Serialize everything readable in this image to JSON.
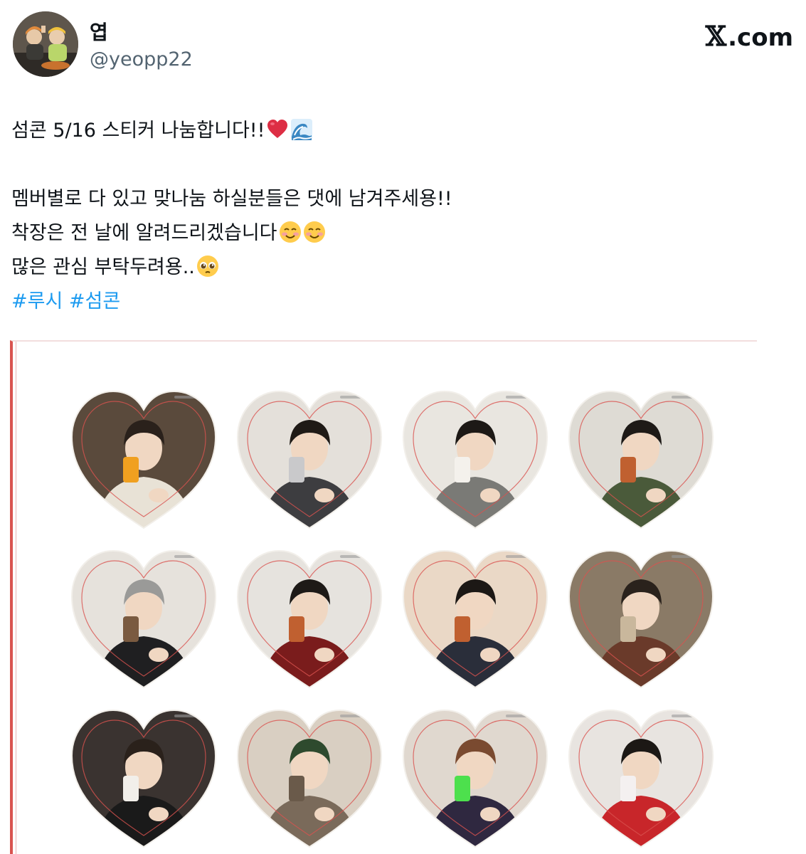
{
  "author": {
    "display_name": "엽",
    "handle": "@yeopp22",
    "avatar": "profile-photo"
  },
  "branding": {
    "logo_mark": "𝕏",
    "logo_text": ".com"
  },
  "tweet": {
    "line1": "섬콘 5/16 스티커 나눔합니다!!",
    "line1_emojis": [
      "red-heart",
      "water-wave"
    ],
    "line2": "멤버별로 다 있고 맞나눔 하실분들은 댓에 남겨주세용!!",
    "line3": "착장은 전 날에 알려드리겠습니다",
    "line3_emojis": [
      "smiling-face",
      "smiling-face"
    ],
    "line4": "많은 관심 부탁두려용..",
    "line4_emojis": [
      "pleading-face"
    ],
    "hashtags": [
      "#루시",
      "#섬콘"
    ]
  },
  "media": {
    "stickers": [
      {
        "bg": "#5a4a3c",
        "shirt": "#e8e2d6",
        "hair": "#2a211b",
        "accent": "#f0a020"
      },
      {
        "bg": "#e4e0da",
        "shirt": "#3d3d40",
        "hair": "#1f1a16",
        "accent": "#c9c9cb"
      },
      {
        "bg": "#e9e6e0",
        "shirt": "#7a7a76",
        "hair": "#1d1916",
        "accent": "#f4f1ec"
      },
      {
        "bg": "#dedbd4",
        "shirt": "#4a5a3a",
        "hair": "#1e1a17",
        "accent": "#c06030"
      },
      {
        "bg": "#e6e2dc",
        "shirt": "#1f1f21",
        "hair": "#9a9a98",
        "accent": "#7a5a40"
      },
      {
        "bg": "#e6e3de",
        "shirt": "#7a1c1c",
        "hair": "#1e1a17",
        "accent": "#c06030"
      },
      {
        "bg": "#ead8c6",
        "shirt": "#2a2e3a",
        "hair": "#1c1815",
        "accent": "#c06030"
      },
      {
        "bg": "#8a7a66",
        "shirt": "#6a3a2a",
        "hair": "#2a221c",
        "accent": "#c9b79c"
      },
      {
        "bg": "#3a3330",
        "shirt": "#1a1a1a",
        "hair": "#2a211b",
        "accent": "#f2efea"
      },
      {
        "bg": "#d9cfc2",
        "shirt": "#7a6a5a",
        "hair": "#2e4a2e",
        "accent": "#6a5a4a"
      },
      {
        "bg": "#e0d8cf",
        "shirt": "#2f2840",
        "hair": "#7a4a30",
        "accent": "#4de04d"
      },
      {
        "bg": "#e8e4e0",
        "shirt": "#c8262a",
        "hair": "#1c1815",
        "accent": "#f4f0f0"
      }
    ]
  }
}
